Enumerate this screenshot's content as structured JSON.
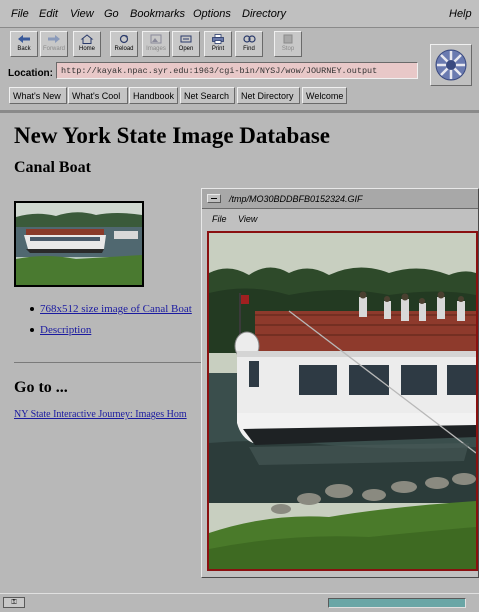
{
  "menubar": {
    "items": [
      "File",
      "Edit",
      "View",
      "Go",
      "Bookmarks",
      "Options",
      "Directory"
    ],
    "help": "Help"
  },
  "toolbar": {
    "buttons": [
      "Back",
      "Forward",
      "Home",
      "Reload",
      "Images",
      "Open",
      "Print",
      "Find",
      "Stop"
    ]
  },
  "location": {
    "label": "Location:",
    "url": "http://kayak.npac.syr.edu:1963/cgi-bin/NYSJ/wow/JOURNEY.output"
  },
  "directory_buttons": [
    "What's New",
    "What's Cool",
    "Handbook",
    "Net Search",
    "Net Directory",
    "Welcome"
  ],
  "page": {
    "title": "New York State Image Database",
    "subtitle": "Canal Boat",
    "links": [
      "768x512 size image of Canal Boat",
      "Description"
    ],
    "goto_heading": "Go to ...",
    "goto_link": "NY State Interactive Journey: Images Hom"
  },
  "image_window": {
    "title": "/tmp/MO30BDDBFB0152324.GIF",
    "menu": [
      "File",
      "View"
    ]
  },
  "colors": {
    "background": "#b8b8b8",
    "location_field": "#e8c8c8",
    "link": "#1a1aa0",
    "progress": "#6aa6a6",
    "photo_frame": "#7a1414"
  }
}
